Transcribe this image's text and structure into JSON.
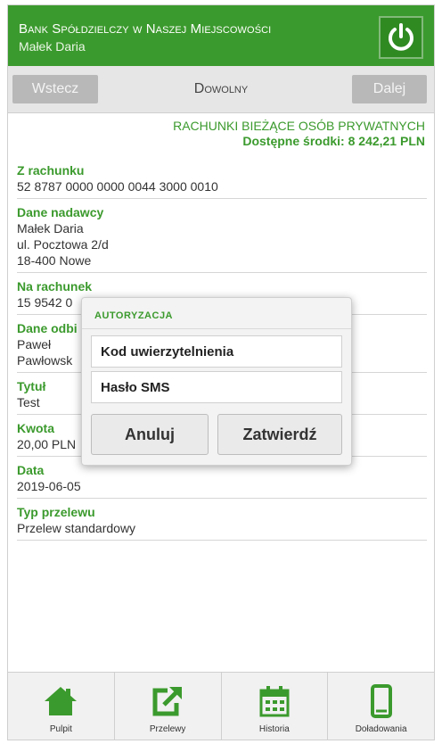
{
  "header": {
    "bank_name": "Bank Spółdzielczy w Naszej Miejscowości",
    "user_name": "Małek Daria",
    "power_icon": "power-icon"
  },
  "nav": {
    "back_label": "Wstecz",
    "title": "Dowolny",
    "next_label": "Dalej"
  },
  "account": {
    "type": "RACHUNKI BIEŻĄCE OSÓB PRYWATNYCH",
    "available": "Dostępne środki: 8 242,21 PLN"
  },
  "form": {
    "from_label": "Z rachunku",
    "from_value": "52 8787 0000 0000 0044 3000 0010",
    "sender_label": "Dane nadawcy",
    "sender_line1": "Małek Daria",
    "sender_line2": "ul. Pocztowa 2/d",
    "sender_line3": "18-400 Nowe",
    "to_label": "Na rachunek",
    "to_value": "15 9542 0",
    "recipient_label": "Dane odbi",
    "recipient_line1": "Paweł",
    "recipient_line2": "Pawłowsk",
    "title_label": "Tytuł",
    "title_value": "Test",
    "amount_label": "Kwota",
    "amount_value": "20,00 PLN",
    "date_label": "Data",
    "date_value": "2019-06-05",
    "type_label": "Typ przelewu",
    "type_value": "Przelew standardowy"
  },
  "dialog": {
    "title": "AUTORYZACJA",
    "code_placeholder": "Kod uwierzytelnienia",
    "sms_placeholder": "Hasło SMS",
    "cancel_label": "Anuluj",
    "confirm_label": "Zatwierdź"
  },
  "tabs": [
    {
      "label": "Pulpit",
      "icon": "home-icon"
    },
    {
      "label": "Przelewy",
      "icon": "transfer-icon"
    },
    {
      "label": "Historia",
      "icon": "calendar-icon"
    },
    {
      "label": "Doładowania",
      "icon": "phone-icon"
    }
  ],
  "colors": {
    "brand_green": "#3b9a2d",
    "nav_gray": "#b8b8b8"
  }
}
